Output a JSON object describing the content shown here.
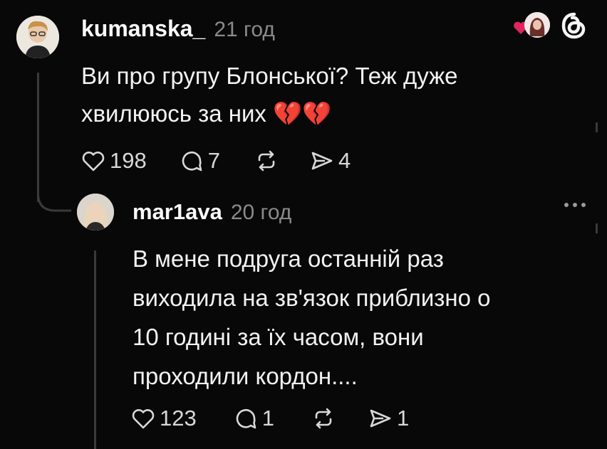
{
  "colors": {
    "background": "#080808",
    "text": "#f5f5f5",
    "muted": "#8a8a8a",
    "heart_red": "#e0245e",
    "broken_heart": "#e8322e"
  },
  "header": {
    "brand_icon": "threads-logo-icon",
    "liked_by_icon": "liked-avatar-icon"
  },
  "post": {
    "username": "kumanska_",
    "time": "21 год",
    "text_lines": [
      "Ви про групу Блонської? Теж дуже",
      "хвилююсь за них 💔💔"
    ],
    "likes": "198",
    "comments": "7",
    "shares": "4"
  },
  "reply": {
    "username": "mar1ava",
    "time": "20 год",
    "more_label": "•••",
    "text_lines": [
      "В мене подруга останній раз",
      "виходила на зв'язок приблизно о",
      "10 годині за їх часом, вони",
      "проходили кордон...."
    ],
    "likes": "123",
    "comments": "1",
    "shares": "1"
  }
}
